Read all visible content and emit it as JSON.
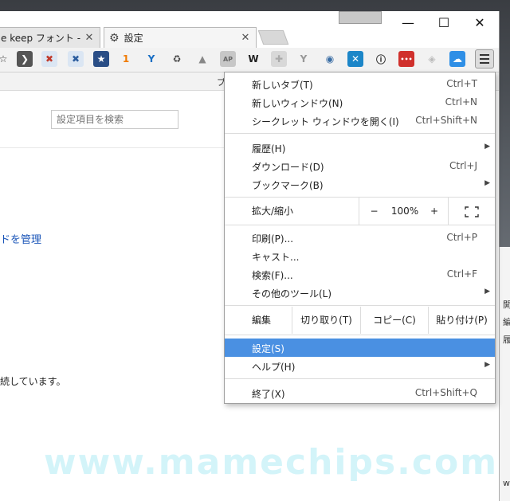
{
  "window": {
    "tabs": [
      {
        "title": "e keep フォント - Goo"
      },
      {
        "title": "設定"
      }
    ],
    "min_icon": "—",
    "max_icon": "☐",
    "close_icon": "✕"
  },
  "toolbar": {
    "extensions": [
      {
        "name": "star-icon",
        "glyph": "☆",
        "color": "#f2f2f2",
        "fg": "#333"
      },
      {
        "name": "pocket-icon",
        "glyph": "❯",
        "color": "#555555",
        "fg": "#fff"
      },
      {
        "name": "tab-close-red-icon",
        "glyph": "✖",
        "color": "#dbe6f3",
        "fg": "#c0392b"
      },
      {
        "name": "tab-close-blue-icon",
        "glyph": "✖",
        "color": "#dbe6f3",
        "fg": "#2c5d9e"
      },
      {
        "name": "bookmark-star-icon",
        "glyph": "★",
        "color": "#2a4e86",
        "fg": "#fff"
      },
      {
        "name": "one-icon",
        "glyph": "1",
        "color": "#f2f2f2",
        "fg": "#f07a00"
      },
      {
        "name": "y-icon",
        "glyph": "Y",
        "color": "#f2f2f2",
        "fg": "#1a6fc4"
      },
      {
        "name": "recycle-icon",
        "glyph": "♻",
        "color": "#f2f2f2",
        "fg": "#444"
      },
      {
        "name": "drive-icon",
        "glyph": "▲",
        "color": "#f2f2f2",
        "fg": "#888"
      },
      {
        "name": "ap-icon",
        "glyph": "AP",
        "color": "#c7c7c7",
        "fg": "#666"
      },
      {
        "name": "wikipedia-icon",
        "glyph": "W",
        "color": "#f2f2f2",
        "fg": "#222"
      },
      {
        "name": "plus-icon",
        "glyph": "✚",
        "color": "#d8d8d8",
        "fg": "#aaa"
      },
      {
        "name": "wrench-icon",
        "glyph": "Y",
        "color": "#f2f2f2",
        "fg": "#999"
      },
      {
        "name": "globe-icon",
        "glyph": "◉",
        "color": "#f2f2f2",
        "fg": "#3b6ea5"
      },
      {
        "name": "x-icon",
        "glyph": "✕",
        "color": "#1c86c8",
        "fg": "#fff"
      },
      {
        "name": "info-icon",
        "glyph": "ⓘ",
        "color": "#f2f2f2",
        "fg": "#222"
      },
      {
        "name": "dots-icon",
        "glyph": "•••",
        "color": "#d0312d",
        "fg": "#fff"
      },
      {
        "name": "shield-icon",
        "glyph": "◈",
        "color": "#f2f2f2",
        "fg": "#bbb"
      },
      {
        "name": "cloud-icon",
        "glyph": "☁",
        "color": "#2f8fe6",
        "fg": "#fff"
      }
    ],
    "menu_label": "≡"
  },
  "bookmark_bar": {
    "label": "ブ"
  },
  "settings_page": {
    "search_placeholder": "設定項目を検索",
    "manage_link": "ドを管理",
    "continue_text": "続しています。"
  },
  "right_window": {
    "lines": [
      "開",
      "編",
      "履",
      "wl"
    ]
  },
  "menu": {
    "new_tab": {
      "label": "新しいタブ(T)",
      "shortcut": "Ctrl+T"
    },
    "new_window": {
      "label": "新しいウィンドウ(N)",
      "shortcut": "Ctrl+N"
    },
    "incognito": {
      "label": "シークレット ウィンドウを開く(I)",
      "shortcut": "Ctrl+Shift+N"
    },
    "history": {
      "label": "履歴(H)"
    },
    "downloads": {
      "label": "ダウンロード(D)",
      "shortcut": "Ctrl+J"
    },
    "bookmarks": {
      "label": "ブックマーク(B)"
    },
    "zoom": {
      "label": "拡大/縮小",
      "minus": "−",
      "level": "100%",
      "plus": "+"
    },
    "print": {
      "label": "印刷(P)...",
      "shortcut": "Ctrl+P"
    },
    "cast": {
      "label": "キャスト..."
    },
    "find": {
      "label": "検索(F)...",
      "shortcut": "Ctrl+F"
    },
    "more_tools": {
      "label": "その他のツール(L)"
    },
    "edit": {
      "label": "編集",
      "cut": "切り取り(T)",
      "copy": "コピー(C)",
      "paste": "貼り付け(P)"
    },
    "settings": {
      "label": "設定(S)"
    },
    "help": {
      "label": "ヘルプ(H)"
    },
    "exit": {
      "label": "終了(X)",
      "shortcut": "Ctrl+Shift+Q"
    },
    "highlight_color": "#4a90e2"
  },
  "watermark": "www.mamechips.com"
}
